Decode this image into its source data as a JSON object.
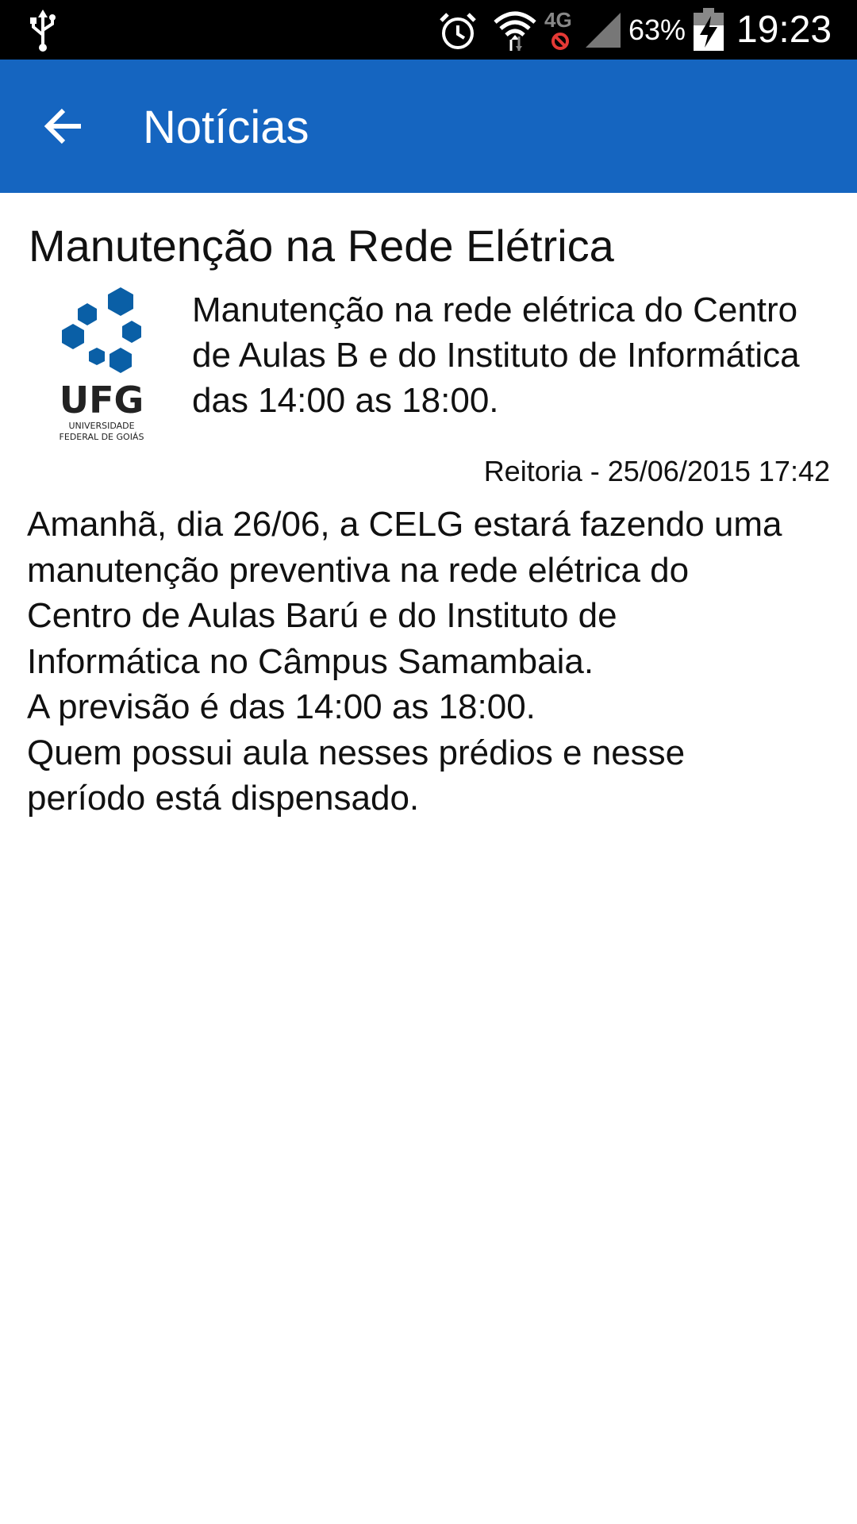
{
  "status_bar": {
    "battery_percent": "63%",
    "time": "19:23",
    "network_label": "4G",
    "icons": [
      "usb-icon",
      "alarm-icon",
      "wifi-icon",
      "4g-no-data-icon",
      "signal-icon",
      "battery-charging-icon"
    ]
  },
  "app_bar": {
    "title": "Notícias",
    "back_icon": "arrow-left-icon",
    "background_color": "#1565c0"
  },
  "article": {
    "title": "Manutenção na Rede Elétrica",
    "logo": {
      "text": "UFG",
      "subtitle_line1": "UNIVERSIDADE",
      "subtitle_line2": "FEDERAL DE GOIÁS",
      "color": "#0a5fa6"
    },
    "summary": "Manutenção na rede elétrica do Centro de Aulas B e do Instituto de Informática das 14:00 as 18:00.",
    "meta": "Reitoria - 25/06/2015 17:42",
    "body_lines": [
      "Amanhã, dia 26/06, a CELG estará fazendo uma",
      "manutenção preventiva na rede elétrica do",
      "Centro de Aulas Barú e do Instituto de",
      "Informática no Câmpus Samambaia.",
      "A previsão é das 14:00 as 18:00.",
      "Quem possui aula nesses prédios e nesse",
      "período está dispensado."
    ]
  }
}
